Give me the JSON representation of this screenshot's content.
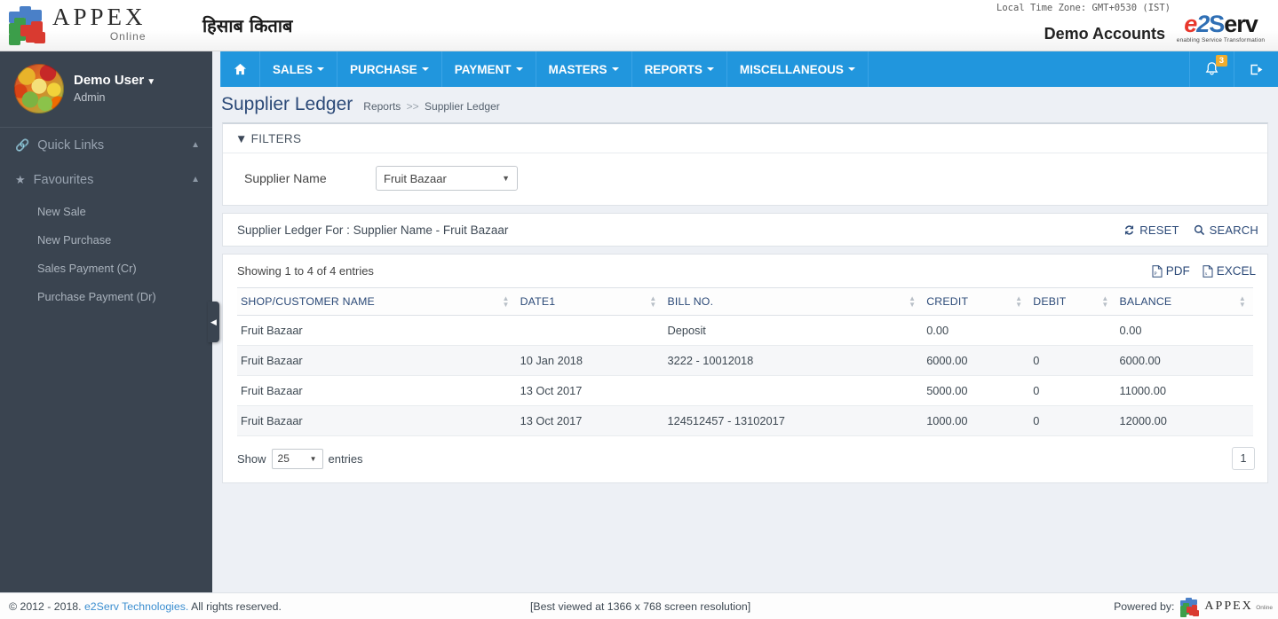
{
  "header": {
    "brand_name": "APPEX",
    "brand_sub": "Online",
    "hindi_title": "हिसाब किताब",
    "timezone": "Local Time Zone: GMT+0530 (IST)",
    "account_name": "Demo Accounts",
    "partner_logo_e": "e",
    "partner_logo_2": "2",
    "partner_logo_s": "S",
    "partner_logo_erv": "erv",
    "partner_tagline": "enabling Service Transformation"
  },
  "navbar": {
    "home_icon": "home-icon",
    "items": [
      {
        "label": "SALES"
      },
      {
        "label": "PURCHASE"
      },
      {
        "label": "PAYMENT"
      },
      {
        "label": "MASTERS"
      },
      {
        "label": "REPORTS"
      },
      {
        "label": "MISCELLANEOUS"
      }
    ],
    "notification_count": "3",
    "notification_icon": "bell-icon",
    "logout_icon": "logout-icon"
  },
  "sidebar": {
    "user_name": "Demo User",
    "user_role": "Admin",
    "quick_links_label": "Quick Links",
    "favourites_label": "Favourites",
    "favourites": [
      {
        "label": "New Sale"
      },
      {
        "label": "New Purchase"
      },
      {
        "label": "Sales Payment (Cr)"
      },
      {
        "label": "Purchase Payment (Dr)"
      }
    ]
  },
  "page": {
    "title": "Supplier Ledger",
    "breadcrumb_parent": "Reports",
    "breadcrumb_sep": ">>",
    "breadcrumb_current": "Supplier Ledger"
  },
  "filters": {
    "heading": "FILTERS",
    "supplier_label": "Supplier Name",
    "supplier_value": "Fruit Bazaar"
  },
  "ledger_bar": {
    "text": "Supplier Ledger For : Supplier Name - Fruit Bazaar",
    "reset_label": "RESET",
    "search_label": "SEARCH"
  },
  "table": {
    "showing": "Showing 1 to 4 of 4 entries",
    "pdf_label": "PDF",
    "excel_label": "EXCEL",
    "columns": [
      "SHOP/CUSTOMER NAME",
      "DATE1",
      "BILL NO.",
      "CREDIT",
      "DEBIT",
      "BALANCE"
    ],
    "rows": [
      {
        "name": "Fruit Bazaar",
        "date": "",
        "bill_no": "Deposit",
        "credit": "0.00",
        "debit": "",
        "balance": "0.00"
      },
      {
        "name": "Fruit Bazaar",
        "date": "10 Jan 2018",
        "bill_no": "3222 - 10012018",
        "credit": "6000.00",
        "debit": "0",
        "balance": "6000.00"
      },
      {
        "name": "Fruit Bazaar",
        "date": "13 Oct 2017",
        "bill_no": "",
        "credit": "5000.00",
        "debit": "0",
        "balance": "11000.00"
      },
      {
        "name": "Fruit Bazaar",
        "date": "13 Oct 2017",
        "bill_no": "124512457 - 13102017",
        "credit": "1000.00",
        "debit": "0",
        "balance": "12000.00"
      }
    ],
    "show_label": "Show",
    "entries_label": "entries",
    "page_size": "25",
    "current_page": "1"
  },
  "footer": {
    "copyright_prefix": "© 2012 - 2018.",
    "company_link": "e2Serv Technologies.",
    "copyright_suffix": "All rights reserved.",
    "best_viewed": "[Best viewed at 1366 x 768 screen resolution]",
    "powered_by": "Powered by:",
    "powered_brand": "APPEX",
    "powered_brand_sub": "Online"
  },
  "colors": {
    "navbar_blue": "#2196dd",
    "sidebar_dark": "#3a4450",
    "title_blue": "#2c4a78",
    "badge_orange": "#f0ad2e",
    "link_blue": "#3b8ed0"
  }
}
